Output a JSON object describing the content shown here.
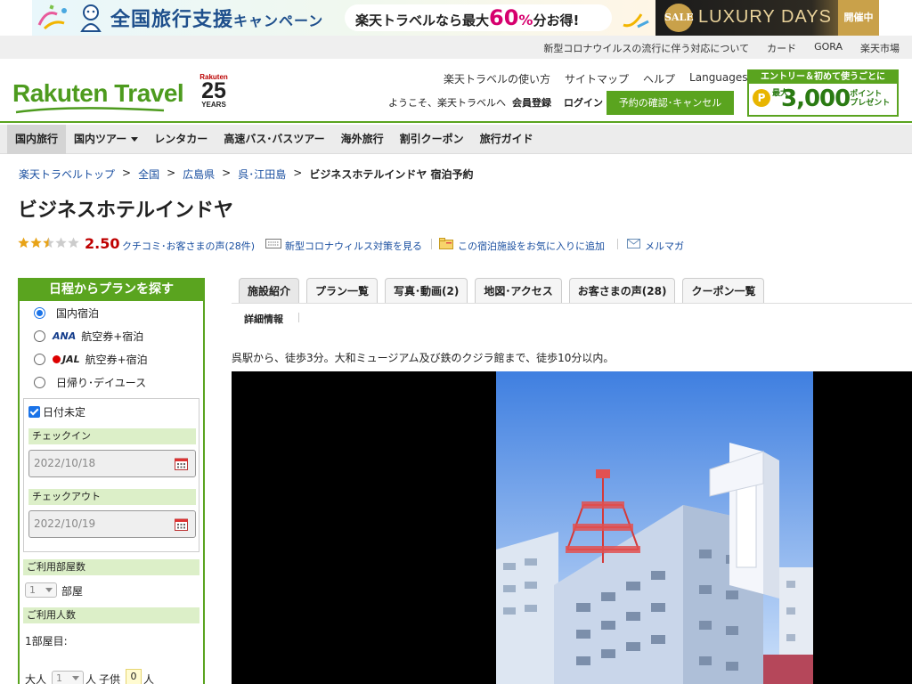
{
  "banner": {
    "campaign_title": "全国旅行支援",
    "campaign_sub": "キャンペーン",
    "pill_prefix": "楽天トラベルなら最大",
    "pill_number": "60",
    "pill_pct": "%",
    "pill_suffix": "分お得!",
    "sale_badge": "SALE",
    "sale_text": "LUXURY DAYS",
    "sale_tag": "開催中"
  },
  "util_links": [
    "新型コロナウイルスの流行に伴う対応について",
    "カード",
    "GORA",
    "楽天市場"
  ],
  "header": {
    "logo": "Rakuten Travel",
    "anniv_top": "Rakuten",
    "anniv_num": "25",
    "anniv_bottom": "YEARS",
    "links": [
      "楽天トラベルの使い方",
      "サイトマップ",
      "ヘルプ"
    ],
    "languages": "Languages",
    "greeting": "ようこそ、楽天トラベルへ",
    "member_register": "会員登録",
    "login": "ログイン",
    "reserve_button": "予約の確認･キャンセル",
    "entry_top": "エントリー＆初めて使うごとに",
    "entry_coin": "P",
    "entry_max": "最大",
    "entry_amount": "3,000",
    "entry_point": "ポイント",
    "entry_present": "プレゼント"
  },
  "gnav": [
    "国内旅行",
    "国内ツアー",
    "レンタカー",
    "高速バス･バスツアー",
    "海外旅行",
    "割引クーポン",
    "旅行ガイド"
  ],
  "breadcrumb": {
    "items": [
      "楽天トラベルトップ",
      "全国",
      "広島県",
      "呉･江田島"
    ],
    "separator": ">",
    "current": "ビジネスホテルインドヤ 宿泊予約"
  },
  "hotel": {
    "name": "ビジネスホテルインドヤ",
    "rating": "2.50",
    "reviews_link": "クチコミ･お客さまの声(28件)",
    "corona_link": "新型コロナウィルス対策を見る",
    "favorite_link": "この宿泊施設をお気に入りに追加",
    "mail_link": "メルマガ",
    "description": "呉駅から、徒歩3分。大和ミュージアム及び鉄のクジラ館まで、徒歩10分以内。"
  },
  "sidebar": {
    "title": "日程からプランを探す",
    "radio_domestic": "国内宿泊",
    "ana_logo": "ANA",
    "jal_logo": "JAL",
    "radio_ana": "航空券+宿泊",
    "radio_jal": "航空券+宿泊",
    "radio_day": "日帰り･デイユース",
    "date_undecided": "日付未定",
    "checkin_label": "チェックイン",
    "checkin_value": "2022/10/18",
    "checkout_label": "チェックアウト",
    "checkout_value": "2022/10/19",
    "rooms_label": "ご利用部屋数",
    "rooms_value": "1",
    "rooms_unit": "部屋",
    "guests_label": "ご利用人数",
    "room1_label": "1部屋目:",
    "adult_label": "大人",
    "adult_value": "1",
    "adult_unit": "人",
    "child_label": "子供",
    "child_value": "0",
    "child_unit": "人"
  },
  "tabs": [
    "施設紹介",
    "プラン一覧",
    "写真･動画(2)",
    "地図･アクセス",
    "お客さまの声(28)",
    "クーポン一覧"
  ],
  "subtab": "詳細情報",
  "colors": {
    "brand_green": "#5aa41f",
    "link_blue": "#1a4fa0",
    "rating_red": "#bf0000"
  }
}
